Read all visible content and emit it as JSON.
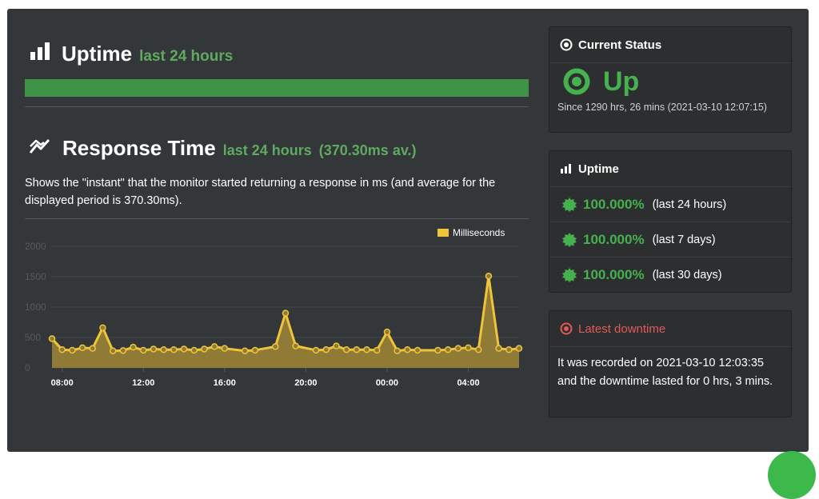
{
  "uptime_section": {
    "title": "Uptime",
    "period": "last 24 hours",
    "uptime_fraction": 1.0
  },
  "response_section": {
    "title": "Response Time",
    "period": "last 24 hours",
    "average": "(370.30ms av.)",
    "description": "Shows the \"instant\" that the monitor started returning a response in ms (and average for the displayed period is 370.30ms)."
  },
  "chart_data": {
    "type": "area",
    "legend": "Milliseconds",
    "legend_position": "top-right",
    "y_ticks": [
      "0",
      "500",
      "1000",
      "1500",
      "2000"
    ],
    "ylim": [
      0,
      2000
    ],
    "x_ticks": [
      "08:00",
      "12:00",
      "16:00",
      "20:00",
      "00:00",
      "04:00"
    ],
    "x_tick_hours": [
      8,
      12,
      16,
      20,
      24,
      28
    ],
    "x_hours": [
      7.5,
      8.0,
      8.5,
      9.0,
      9.5,
      10.0,
      10.5,
      11.0,
      11.5,
      12.0,
      12.5,
      13.0,
      13.5,
      14.0,
      14.5,
      15.0,
      15.5,
      16.0,
      17.0,
      17.5,
      18.5,
      19.0,
      19.5,
      20.5,
      21.0,
      21.5,
      22.0,
      22.5,
      23.0,
      23.5,
      24.0,
      24.5,
      25.0,
      25.5,
      26.5,
      27.0,
      27.5,
      28.0,
      28.5,
      29.0,
      29.5,
      30.0,
      30.5
    ],
    "values": [
      480,
      300,
      290,
      330,
      320,
      660,
      280,
      285,
      340,
      290,
      310,
      300,
      300,
      310,
      290,
      310,
      350,
      320,
      280,
      290,
      350,
      900,
      360,
      290,
      300,
      360,
      300,
      300,
      300,
      290,
      590,
      280,
      300,
      290,
      290,
      300,
      320,
      330,
      300,
      1510,
      320,
      300,
      320
    ],
    "colors": {
      "line": "#f0c43a",
      "fill": "#8f7a36",
      "grid": "#44484b",
      "ticks": "#555a5e",
      "xtick_text": "#ffffff"
    },
    "grid": true
  },
  "current_status": {
    "header": "Current Status",
    "status": "Up",
    "since": "Since 1290 hrs, 26 mins (2021-03-10 12:07:15)"
  },
  "uptime_card": {
    "header": "Uptime",
    "rows": [
      {
        "percent": "100.000%",
        "period": "(last 24 hours)"
      },
      {
        "percent": "100.000%",
        "period": "(last 7 days)"
      },
      {
        "percent": "100.000%",
        "period": "(last 30 days)"
      }
    ]
  },
  "latest_downtime": {
    "header": "Latest downtime",
    "text": "It was recorded on 2021-03-10 12:03:35 and the downtime lasted for 0 hrs, 3 mins."
  },
  "colors": {
    "accent_green": "#5fa960",
    "status_green": "#46b24f",
    "downtime_red": "#e05a5a",
    "chart_yellow": "#f0c43a"
  }
}
